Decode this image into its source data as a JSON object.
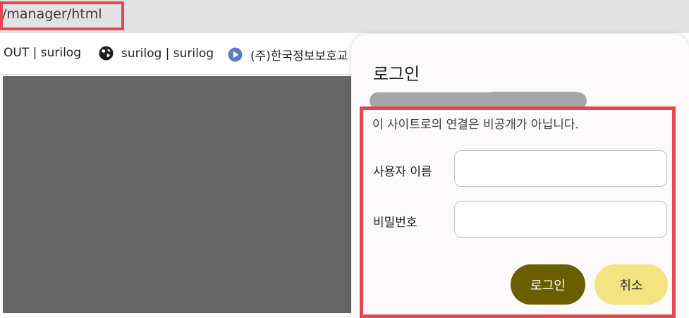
{
  "address_bar": {
    "url_text": "/manager/html"
  },
  "bookmarks": [
    {
      "label": "OUT | surilog",
      "icon": "none"
    },
    {
      "label": "surilog | surilog",
      "icon": "globe-icon"
    },
    {
      "label": "(주)한국정보보호교",
      "icon": "play-icon"
    }
  ],
  "dialog": {
    "title": "로그인",
    "message": "이 사이트로의 연결은 비공개가 아닙니다.",
    "username_label": "사용자 이름",
    "password_label": "비밀번호",
    "login_button": "로그인",
    "cancel_button": "취소"
  },
  "colors": {
    "highlight": "#e34850",
    "login_button_bg": "#6b5e00",
    "cancel_button_bg": "#f3e481",
    "content_bg": "#666666"
  }
}
